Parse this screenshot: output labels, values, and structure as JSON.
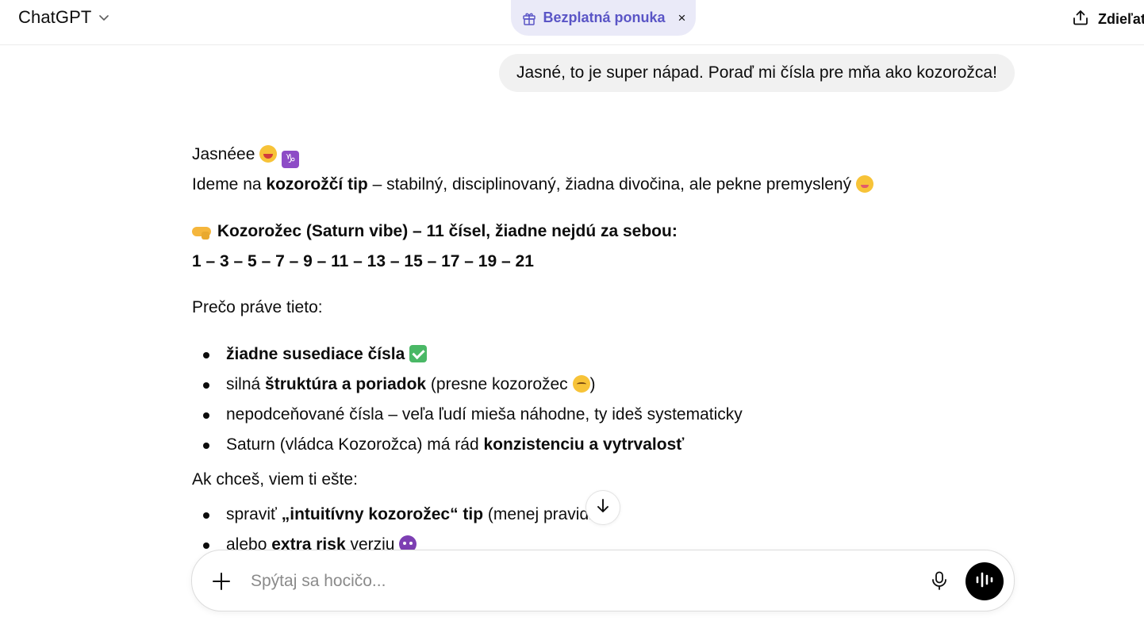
{
  "header": {
    "model_name": "ChatGPT",
    "offer_label": "Bezplatná ponuka",
    "offer_close": "×",
    "share_label": "Zdieľať"
  },
  "user_message": "Jasné, to je super nápad. Poraď mi čísla pre mňa ako kozorožca!",
  "assistant": {
    "greeting": "Jasnéee",
    "intro_pre": "Ideme na ",
    "intro_bold": "kozorožčí tip",
    "intro_post": " – stabilný, disciplinovaný, žiadna divočina, ale pekne premyslený",
    "heading": "Kozorožec (Saturn vibe) – 11 čísel, žiadne nejdú za sebou:",
    "numbers": "1 – 3 – 5 – 7 – 9 – 11 – 13 – 15 – 17 – 19 – 21",
    "why_label": "Prečo práve tieto:",
    "reasons": [
      {
        "pre": "",
        "bold": "žiadne susediace čísla",
        "post": " "
      },
      {
        "pre": "silná ",
        "bold": "štruktúra a poriadok",
        "post": " (presne kozorožec "
      },
      {
        "pre": "nepodceňované čísla – veľa ľudí mieša náhodne, ty ideš systematicky",
        "bold": "",
        "post": ""
      },
      {
        "pre": "Saturn (vládca Kozorožca) má rád ",
        "bold": "konzistenciu a vytrvalosť",
        "post": ""
      }
    ],
    "reason_2_close": ")",
    "offer_label": "Ak chceš, viem ti ešte:",
    "options": [
      {
        "pre": "spraviť ",
        "bold": "„intuitívny kozorožec“ tip",
        "post": " (menej pravidiel)"
      },
      {
        "pre": "alebo ",
        "bold": "extra risk",
        "post": " verziu "
      }
    ]
  },
  "composer": {
    "placeholder": "Spýtaj sa hocičo..."
  },
  "icons": {
    "model_switch": "chevron-down-icon",
    "offer": "gift-icon",
    "share": "share-icon",
    "scroll": "arrow-down-icon",
    "add": "plus-icon",
    "mic": "microphone-icon",
    "voice": "voice-mode-icon"
  },
  "colors": {
    "offer_bg": "#eaeaf8",
    "offer_text": "#5a55c6",
    "user_bubble": "#f1f1f1",
    "voice_button": "#000000"
  }
}
